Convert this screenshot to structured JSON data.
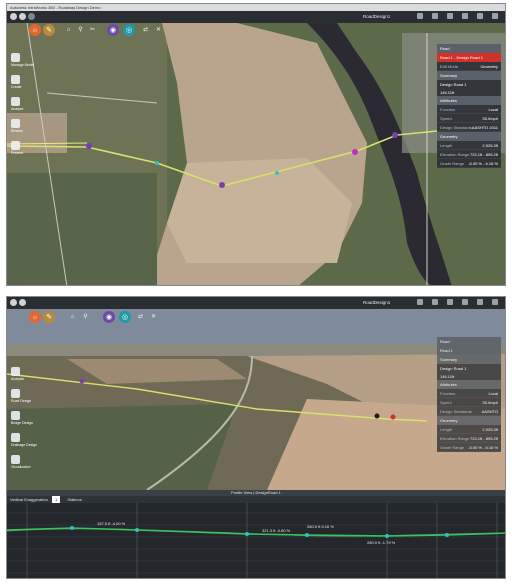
{
  "screen1": {
    "title": "Autodesk InfraWorks 360 - Roadway Design Demo",
    "toolbar_title": "RoadDesign1",
    "panel": {
      "header": "Road",
      "selected": "Road 1 - Design Road 1",
      "mode_label": "Edit Mode",
      "mode_value": "Geometry",
      "sections": [
        {
          "title": "Summary",
          "rows": [
            {
              "k": "Design Road 1",
              "v": ""
            },
            {
              "k": "146.11ft",
              "v": ""
            }
          ]
        },
        {
          "title": "Attributes",
          "rows": [
            {
              "k": "Function",
              "v": "Local"
            },
            {
              "k": "Speed",
              "v": "35.0mph"
            },
            {
              "k": "Design Standards",
              "v": "AASHTO 2011"
            }
          ]
        },
        {
          "title": "Geometry",
          "rows": [
            {
              "k": "Length",
              "v": "2,925.3ft"
            },
            {
              "k": "Elevation Range",
              "v": "723.1ft - 895.2ft"
            },
            {
              "k": "Grade Range",
              "v": "-5.00 % - 6.16 %"
            }
          ]
        }
      ]
    },
    "rail": [
      {
        "label": "Manage Model"
      },
      {
        "label": "Create"
      },
      {
        "label": "Analyze"
      },
      {
        "label": "Review"
      },
      {
        "label": "Present"
      }
    ]
  },
  "screen2": {
    "toolbar_title": "RoadDesign1",
    "panel": {
      "header": "Road",
      "selected": "Road 1",
      "sections": [
        {
          "title": "Summary",
          "rows": [
            {
              "k": "Design Road 1",
              "v": ""
            },
            {
              "k": "146.11ft",
              "v": ""
            }
          ]
        },
        {
          "title": "Attributes",
          "rows": [
            {
              "k": "Function",
              "v": "Local"
            },
            {
              "k": "Speed",
              "v": "35.0mph"
            },
            {
              "k": "Design Standards",
              "v": "AASHTO"
            }
          ]
        },
        {
          "title": "Geometry",
          "rows": [
            {
              "k": "Length",
              "v": "2,925.3ft"
            },
            {
              "k": "Elevation Range",
              "v": "723.1ft - 895.2ft"
            },
            {
              "k": "Grade Range",
              "v": "-5.00 % - 6.16 %"
            }
          ]
        }
      ]
    },
    "rail": [
      {
        "label": "Analysis"
      },
      {
        "label": "Road Design"
      },
      {
        "label": "Bridge Design"
      },
      {
        "label": "Drainage Design"
      },
      {
        "label": "Visualization"
      }
    ],
    "profile": {
      "header": "Profile View | DesignRoad 1",
      "controls": "Vertical Exaggeration",
      "exaggeration": "1",
      "unit_label": "Stations",
      "annotations": [
        "157.5 ft  -4.00 %",
        "321.3 ft  -0.80 %",
        "260.0 ft  6.16 %",
        "280.0 ft  -1.79 %"
      ]
    }
  },
  "colors": {
    "accent": "#d0322b",
    "road_line": "#d6e26a",
    "profile_line": "#34c759"
  }
}
